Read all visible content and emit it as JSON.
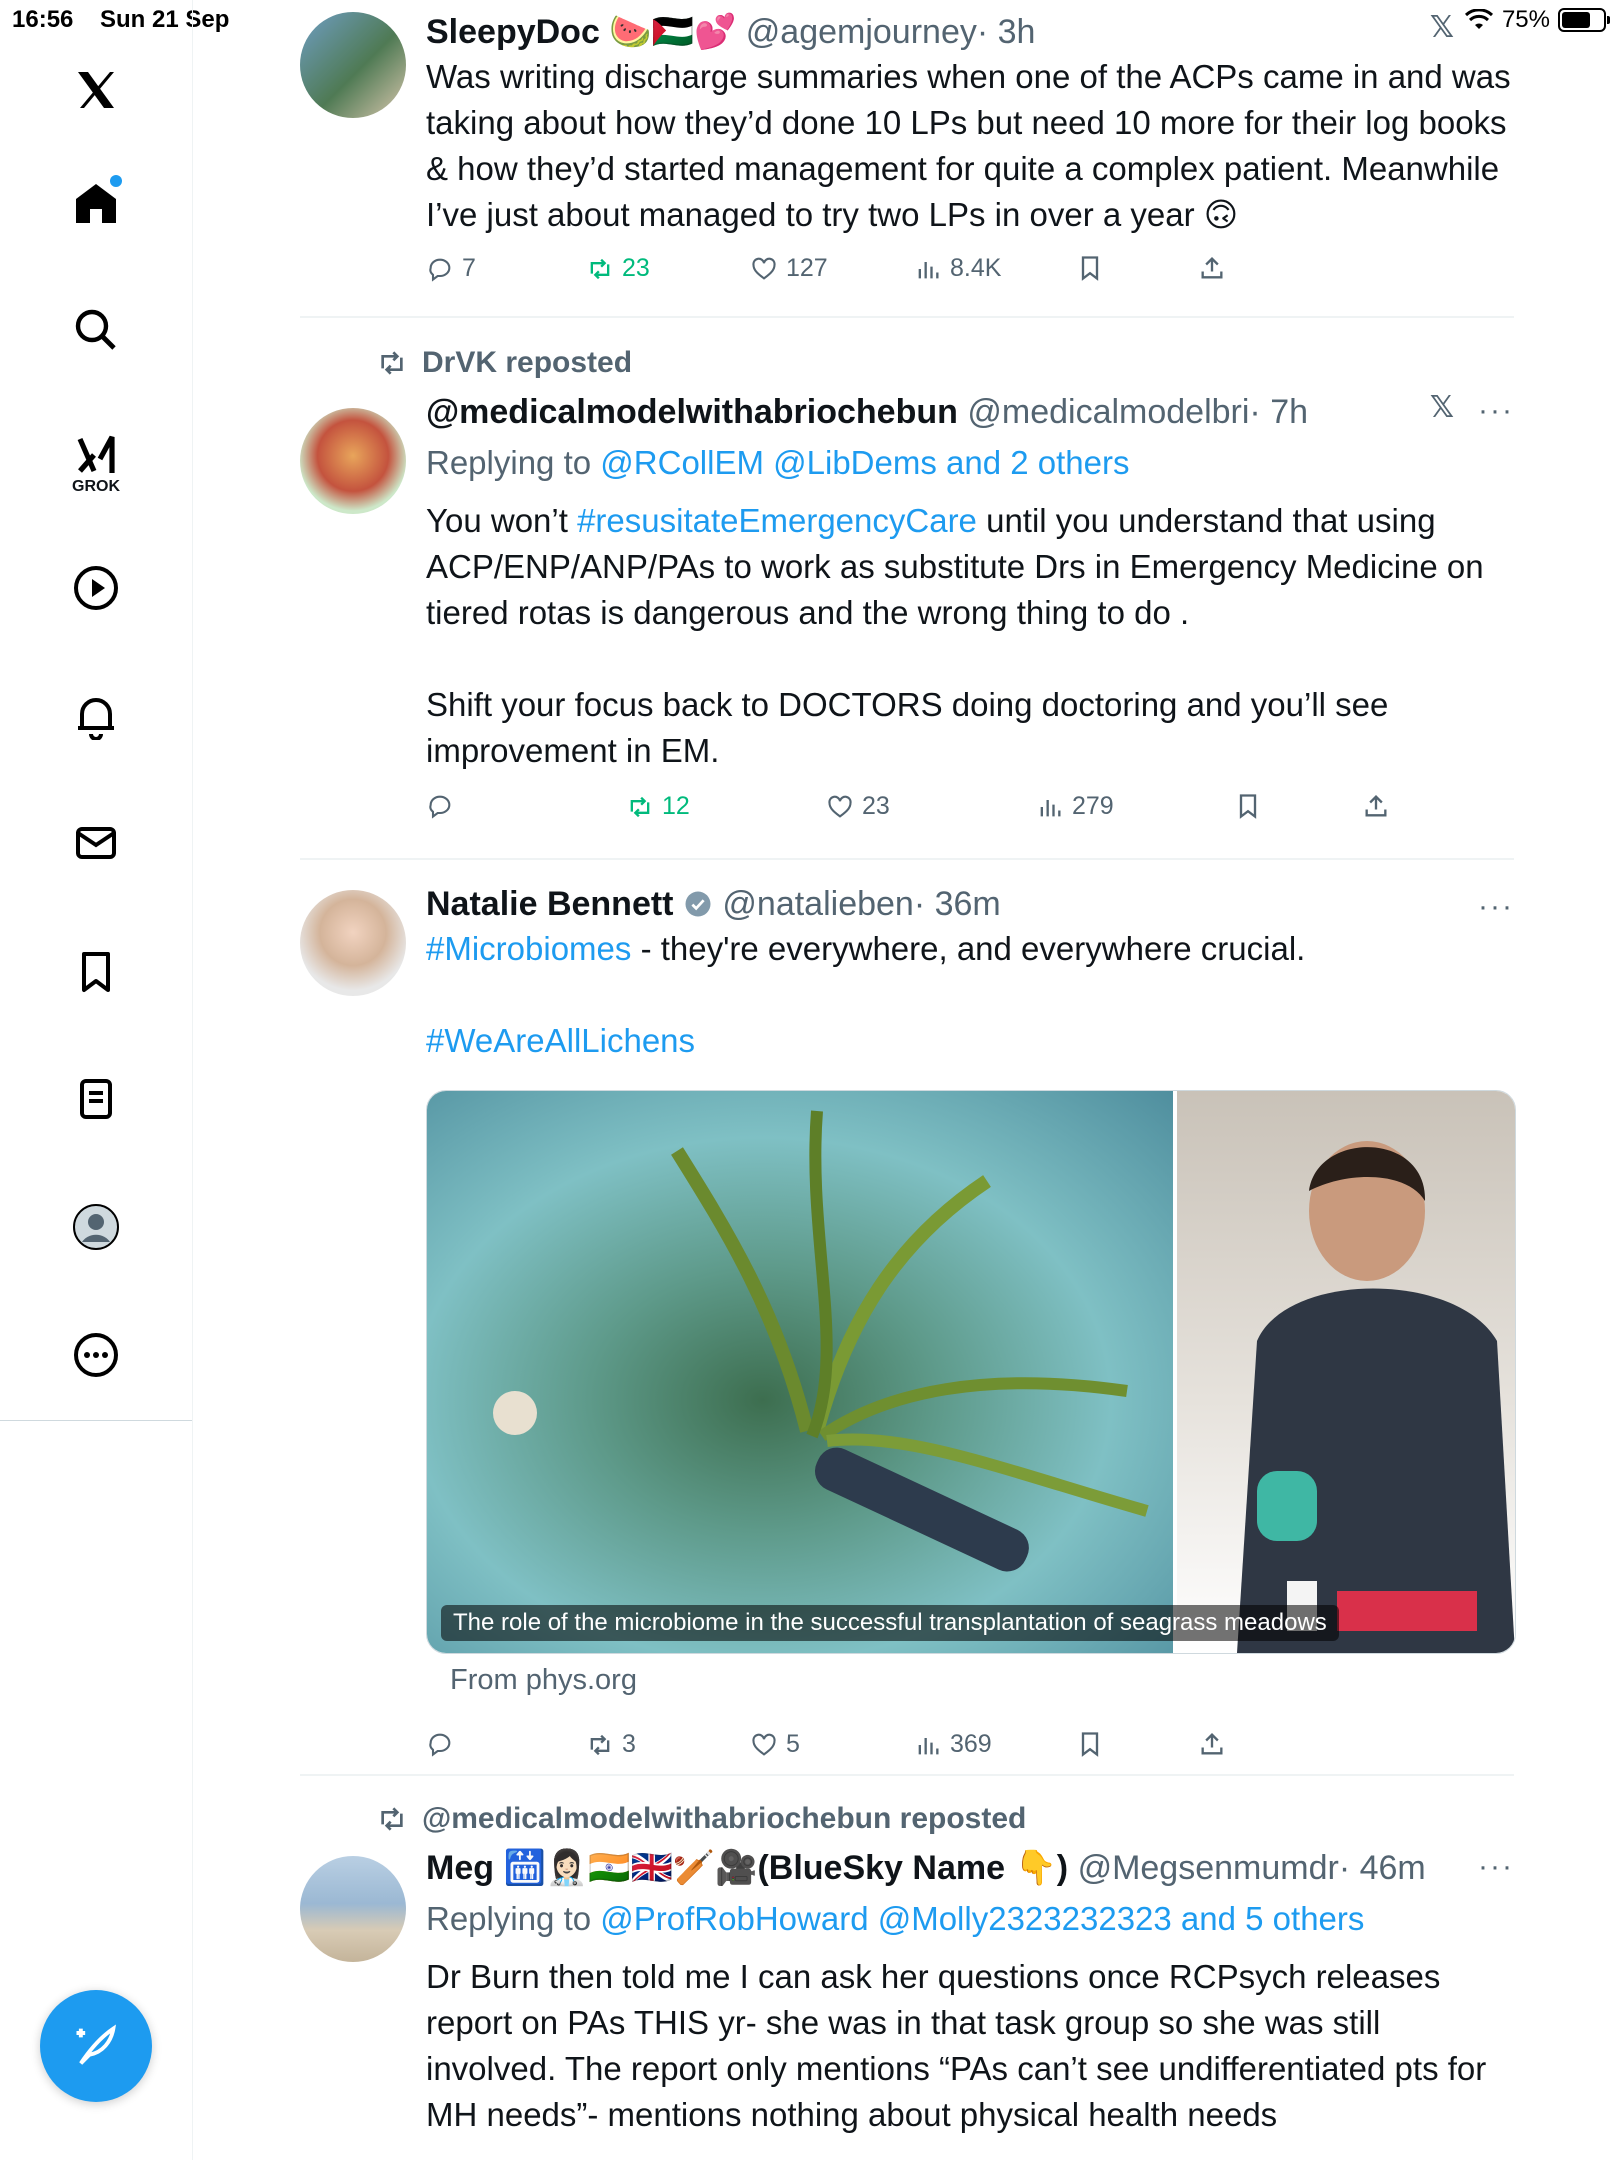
{
  "status_bar": {
    "time": "16:56",
    "date": "Sun 21 Sep",
    "battery": "75%",
    "battery_level": 0.75
  },
  "sidebar": {
    "grok_label": "GROK",
    "items": [
      "x-logo",
      "home",
      "explore",
      "grok",
      "video",
      "notifications",
      "messages",
      "bookmarks",
      "lists",
      "profile",
      "more"
    ]
  },
  "tweets": [
    {
      "name": "SleepyDoc",
      "emoji": "🍉🇵🇸💕",
      "handle": "@agemjourney",
      "time": "· 3h",
      "text": "Was writing discharge summaries when one of the ACPs came in and was taking about how they’d done 10 LPs but need 10 more for their log books & how they’d started management for quite a complex patient. Meanwhile I’ve just about managed to try two LPs in over a year 🙃",
      "replies": "7",
      "reposts": "23",
      "likes": "127",
      "views": "8.4K"
    },
    {
      "repost_by": "DrVK reposted",
      "name": "@medicalmodelwithabriochebun",
      "handle": "@medicalmodelbri",
      "time": "· 7h",
      "reply_prefix": "Replying to",
      "reply_targets": "@RCollEM @LibDems and 2 others",
      "text_pre": "You won’t ",
      "hashtag": "#resusitateEmergencyCare",
      "text_post": " until you understand that using ACP/ENP/ANP/PAs to work as substitute Drs in Emergency Medicine on tiered rotas is dangerous and the wrong thing to do .\n\nShift your focus back to DOCTORS doing doctoring and you’ll see improvement in EM.",
      "replies": "",
      "reposts": "12",
      "likes": "23",
      "views": "279"
    },
    {
      "name": "Natalie Bennett",
      "handle": "@natalieben",
      "time": "· 36m",
      "hashtag1": "#Microbiomes",
      "text1": " - they're everywhere, and everywhere crucial.",
      "hashtag2": "#WeAreAllLichens",
      "media_caption": "The role of the microbiome in the successful transplantation of seagrass meadows",
      "from": "From phys.org",
      "replies": "",
      "reposts": "3",
      "likes": "5",
      "views": "369"
    },
    {
      "repost_by": "@medicalmodelwithabriochebun reposted",
      "name": "Meg 🛗👩🏻‍⚕️🇮🇳🇬🇧🏏🎥(BlueSky Name 👇)",
      "handle": "@Megsenmumdr",
      "time": "· 46m",
      "reply_prefix": "Replying to",
      "reply_targets": "@ProfRobHoward @Molly2323232323 and 5 others",
      "text": "Dr Burn then told me I can ask her questions once RCPsych releases report on PAs THIS yr- she was in that task group so she was still involved. The report only mentions “PAs can’t see undifferentiated pts for MH needs”- mentions nothing about physical health needs"
    }
  ],
  "colors": {
    "accent": "#1d9bf0",
    "repost_green": "#00ba7c",
    "muted": "#536471"
  }
}
